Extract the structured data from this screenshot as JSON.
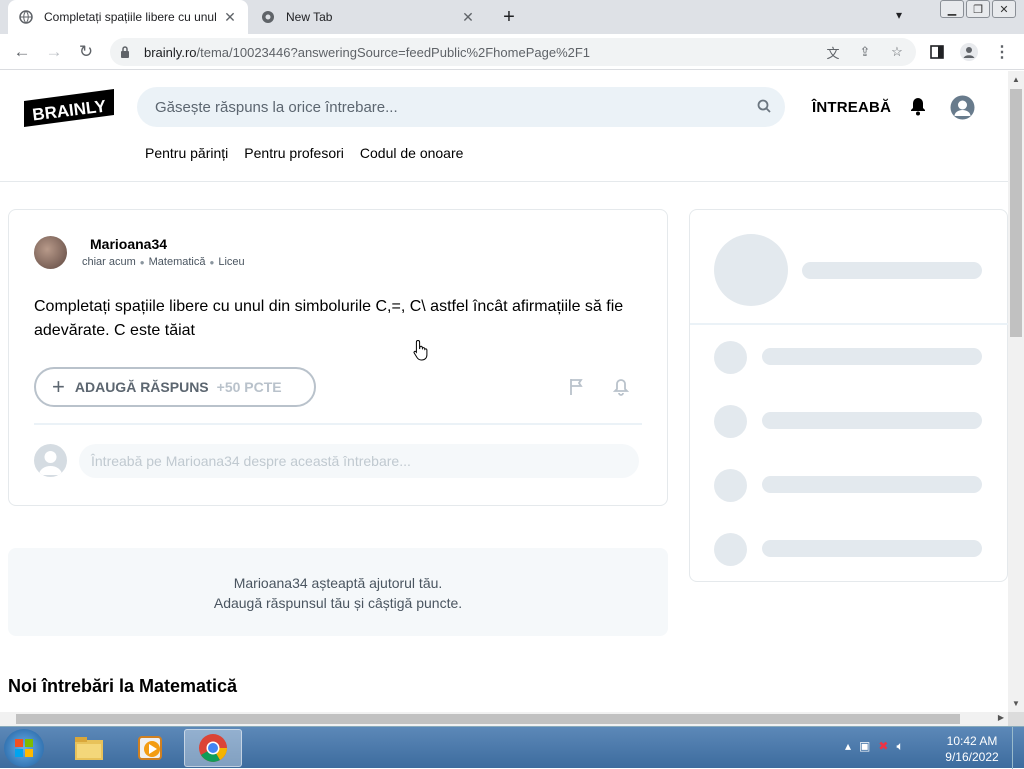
{
  "browser": {
    "tabs": [
      {
        "title": "Completați spațiile libere cu unul",
        "active": true
      },
      {
        "title": "New Tab",
        "active": false
      }
    ],
    "url_host": "brainly.ro",
    "url_path": "/tema/10023446?answeringSource=feedPublic%2FhomePage%2F1"
  },
  "header": {
    "logo_text": "BRAINLY",
    "search_placeholder": "Găsește răspuns la orice întrebare...",
    "ask_label": "ÎNTREABĂ",
    "nav": [
      "Pentru părinți",
      "Pentru profesori",
      "Codul de onoare"
    ]
  },
  "question": {
    "username": "Marioana34",
    "time": "chiar acum",
    "subject": "Matematică",
    "level": "Liceu",
    "text": "Completați spațiile libere cu unul din simbolurile C,=, C\\ astfel încât afirmațiile să fie adevărate. C este tăiat",
    "answer_label": "ADAUGĂ RĂSPUNS",
    "answer_points": "+50 PCTE",
    "comment_placeholder": "Întreabă pe Marioana34 despre această întrebare..."
  },
  "help": {
    "line1": "Marioana34 așteaptă ajutorul tău.",
    "line2": "Adaugă răspunsul tău și câștigă puncte."
  },
  "section_title": "Noi întrebări la Matematică",
  "clock": {
    "time": "10:42 AM",
    "date": "9/16/2022"
  },
  "colors": {
    "accent_bg": "#ebf2f7",
    "brand": "#000000",
    "skeleton": "#e3e9ee"
  }
}
